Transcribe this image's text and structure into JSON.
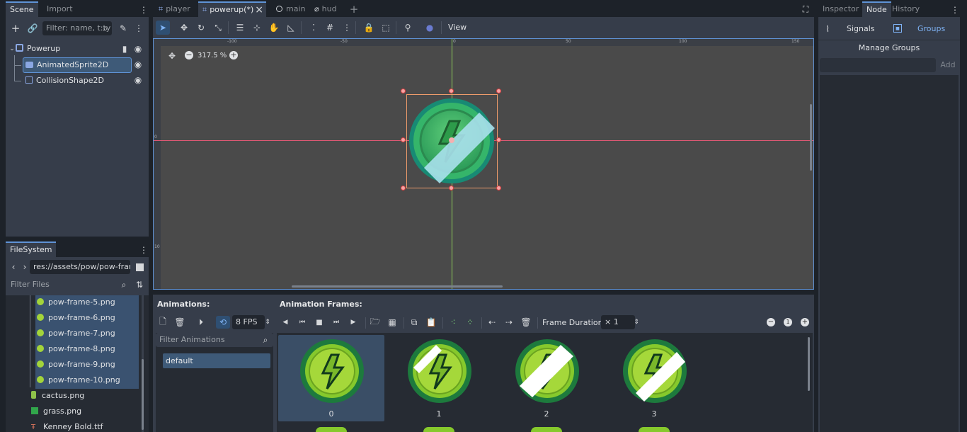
{
  "scene_dock": {
    "tabs": [
      "Scene",
      "Import"
    ],
    "filter_placeholder": "Filter: name, t:ty",
    "nodes": [
      {
        "label": "Powerup",
        "icon": "node2d-icon"
      },
      {
        "label": "AnimatedSprite2D",
        "icon": "animated-sprite-icon"
      },
      {
        "label": "CollisionShape2D",
        "icon": "collision-shape-icon"
      }
    ]
  },
  "filesystem": {
    "tab": "FileSystem",
    "path": "res://assets/pow/pow-frame-",
    "filter_placeholder": "Filter Files",
    "files": [
      "pow-frame-5.png",
      "pow-frame-6.png",
      "pow-frame-7.png",
      "pow-frame-8.png",
      "pow-frame-9.png",
      "pow-frame-10.png",
      "cactus.png",
      "grass.png",
      "Kenney Bold.ttf"
    ]
  },
  "editor_tabs": [
    {
      "label": "player"
    },
    {
      "label": "powerup(*)",
      "close": "×"
    },
    {
      "label": "main"
    },
    {
      "label": "hud"
    }
  ],
  "toolbar": {
    "view_label": "View"
  },
  "viewport": {
    "zoom": "317.5 %",
    "ruler_labels": [
      "-100",
      "-50",
      "0",
      "50",
      "100",
      "150"
    ],
    "left_ruler_labels": [
      "0",
      "10"
    ]
  },
  "right_dock": {
    "tabs": [
      "Inspector",
      "Node",
      "History"
    ],
    "subtabs": [
      "Signals",
      "Groups"
    ],
    "manage_groups": "Manage Groups",
    "add_label": "Add"
  },
  "bottom_panel": {
    "animations_title": "Animations:",
    "frames_title": "Animation Frames:",
    "fps": "8 FPS",
    "frame_duration_label": "Frame Duration:",
    "frame_duration_value": "× 1",
    "filter_animations_placeholder": "Filter Animations",
    "animation_list": [
      "default"
    ],
    "frames": [
      "0",
      "1",
      "2",
      "3"
    ]
  },
  "colors": {
    "accent": "#5f93d6",
    "panel": "#363d4a",
    "background": "#1d2229",
    "canvas": "#4a4a4a",
    "selection": "#ef9c6b"
  }
}
